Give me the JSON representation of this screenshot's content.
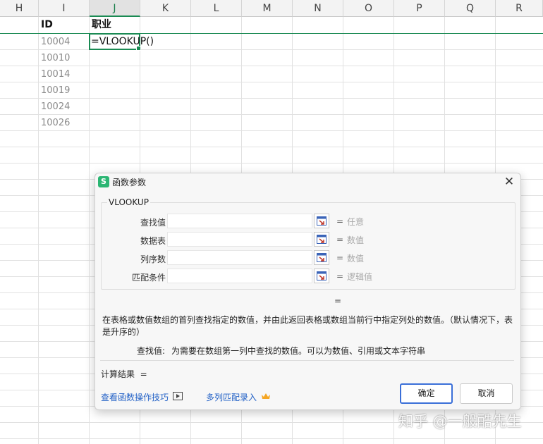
{
  "columns": [
    "H",
    "I",
    "J",
    "K",
    "L",
    "M",
    "N",
    "O",
    "P",
    "Q",
    "R"
  ],
  "selected_column": "J",
  "cells": {
    "id_header": "ID",
    "occupation_header": "职业",
    "active_formula": "=VLOOKUP()",
    "ids": [
      "10004",
      "10010",
      "10014",
      "10019",
      "10024",
      "10026"
    ]
  },
  "dialog": {
    "title": "函数参数",
    "app_icon_letter": "S",
    "function_name": "VLOOKUP",
    "args": [
      {
        "label": "查找值",
        "value": "",
        "equals": "=",
        "hint": "任意"
      },
      {
        "label": "数据表",
        "value": "",
        "equals": "=",
        "hint": "数值"
      },
      {
        "label": "列序数",
        "value": "",
        "equals": "=",
        "hint": "数值"
      },
      {
        "label": "匹配条件",
        "value": "",
        "equals": "=",
        "hint": "逻辑值"
      }
    ],
    "result_equals": "=",
    "description": "在表格或数值数组的首列查找指定的数值，并由此返回表格或数组当前行中指定列处的数值。（默认情况下，表是升序的）",
    "arg_desc_label": "查找值:",
    "arg_desc": "为需要在数组第一列中查找的数值。可以为数值、引用或文本字符串",
    "calc_result": "计算结果  =",
    "link_tips": "查看函数操作技巧",
    "link_multi": "多列匹配录入",
    "ok": "确定",
    "cancel": "取消",
    "crown_color": "#f5a623"
  },
  "watermark": "知乎 @一般酷先生"
}
